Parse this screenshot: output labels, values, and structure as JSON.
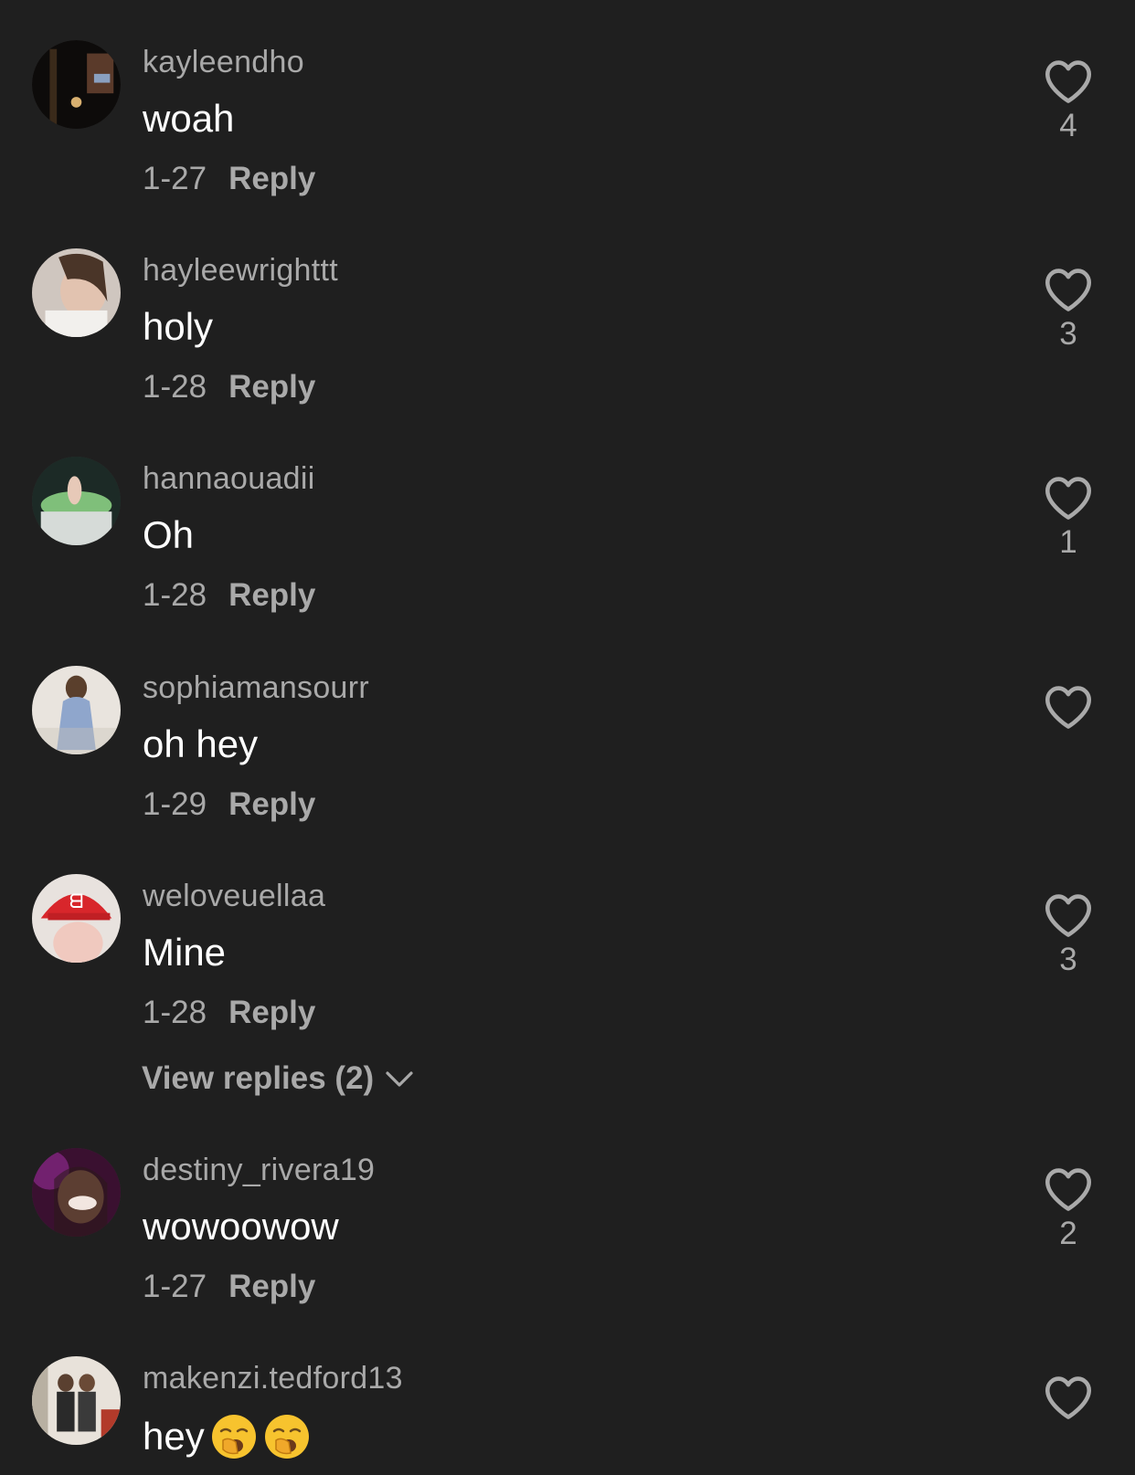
{
  "comments": [
    {
      "username": "kayleendho",
      "text": "woah",
      "date": "1-27",
      "reply_label": "Reply",
      "likes": "4"
    },
    {
      "username": "hayleewrighttt",
      "text": "holy",
      "date": "1-28",
      "reply_label": "Reply",
      "likes": "3"
    },
    {
      "username": "hannaouadii",
      "text": "Oh",
      "date": "1-28",
      "reply_label": "Reply",
      "likes": "1"
    },
    {
      "username": "sophiamansourr",
      "text": "oh hey",
      "date": "1-29",
      "reply_label": "Reply",
      "likes": ""
    },
    {
      "username": "weloveuellaa",
      "text": "Mine",
      "date": "1-28",
      "reply_label": "Reply",
      "likes": "3",
      "view_replies_label": "View replies (2)"
    },
    {
      "username": "destiny_rivera19",
      "text": "wowoowow",
      "date": "1-27",
      "reply_label": "Reply",
      "likes": "2"
    },
    {
      "username": "makenzi.tedford13",
      "text": "hey",
      "emojis": [
        "yawning-face-emoji",
        "yawning-face-emoji"
      ],
      "likes": ""
    }
  ],
  "colors": {
    "background": "#1f1f1f",
    "secondary_text": "#a9a9a9",
    "primary_text": "#ffffff"
  },
  "icons": {
    "like": "heart-outline-icon",
    "expand": "chevron-down-icon"
  }
}
